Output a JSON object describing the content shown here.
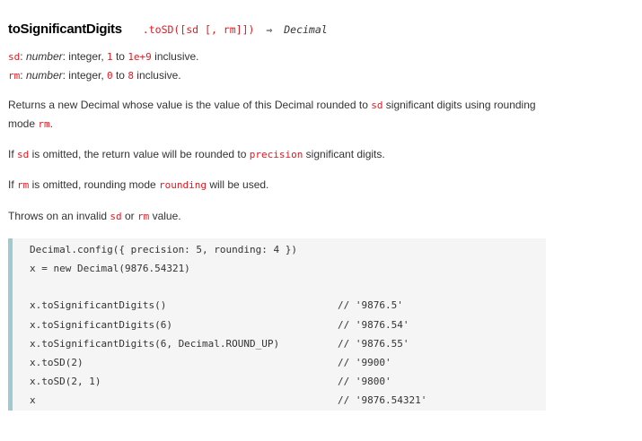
{
  "heading": {
    "method": "toSignificantDigits",
    "signature_alias": ".toSD([sd [, rm]])",
    "arrow": "⇒",
    "return_type": "Decimal"
  },
  "params": [
    {
      "name": "sd",
      "colon": ":",
      "type": "number",
      "desc_a": ": integer, ",
      "min": "1",
      "to": " to ",
      "max": "1e+9",
      "suffix": " inclusive."
    },
    {
      "name": "rm",
      "colon": ":",
      "type": "number",
      "desc_a": ": integer, ",
      "min": "0",
      "to": " to ",
      "max": "8",
      "suffix": " inclusive."
    }
  ],
  "paragraphs": {
    "p1_a": "Returns a new Decimal whose value is the value of this Decimal rounded to ",
    "p1_code1": "sd",
    "p1_b": " significant digits using rounding mode ",
    "p1_code2": "rm",
    "p1_c": ".",
    "p2_a": "If ",
    "p2_code1": "sd",
    "p2_b": " is omitted, the return value will be rounded to ",
    "p2_code2": "precision",
    "p2_c": " significant digits.",
    "p3_a": "If ",
    "p3_code1": "rm",
    "p3_b": " is omitted, rounding mode ",
    "p3_code2": "rounding",
    "p3_c": " will be used.",
    "p4_a": "Throws on an invalid ",
    "p4_code1": "sd",
    "p4_b": " or ",
    "p4_code2": "rm",
    "p4_c": " value."
  },
  "code": {
    "lines": [
      {
        "code": "Decimal.config({ precision: 5, rounding: 4 })",
        "comment": ""
      },
      {
        "code": "x = new Decimal(9876.54321)",
        "comment": ""
      },
      {
        "code": "x.toSignificantDigits()",
        "comment": "// '9876.5'"
      },
      {
        "code": "x.toSignificantDigits(6)",
        "comment": "// '9876.54'"
      },
      {
        "code": "x.toSignificantDigits(6, Decimal.ROUND_UP)",
        "comment": "// '9876.55'"
      },
      {
        "code": "x.toSD(2)",
        "comment": "// '9900'"
      },
      {
        "code": "x.toSD(2, 1)",
        "comment": "// '9800'"
      },
      {
        "code": "x",
        "comment": "// '9876.54321'"
      }
    ]
  },
  "colors": {
    "code_red": "#e8171f",
    "code_bg": "#f5f5f5",
    "code_border": "#9ecad0"
  }
}
